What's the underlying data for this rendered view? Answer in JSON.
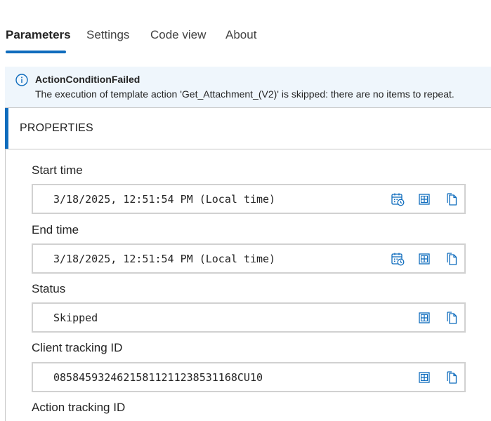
{
  "tabs": [
    {
      "label": "Parameters",
      "active": true
    },
    {
      "label": "Settings",
      "active": false
    },
    {
      "label": "Code view",
      "active": false
    },
    {
      "label": "About",
      "active": false
    }
  ],
  "banner": {
    "icon": "info-icon",
    "title": "ActionConditionFailed",
    "message": "The execution of template action 'Get_Attachment_(V2)' is skipped: there are no items to repeat."
  },
  "section": {
    "title": "PROPERTIES"
  },
  "fields": [
    {
      "label": "Start time",
      "value": "3/18/2025, 12:51:54 PM (Local time)",
      "actions": [
        "calendar-clock-icon",
        "table-view-icon",
        "copy-icon"
      ]
    },
    {
      "label": "End time",
      "value": "3/18/2025, 12:51:54 PM (Local time)",
      "actions": [
        "calendar-clock-icon",
        "table-view-icon",
        "copy-icon"
      ]
    },
    {
      "label": "Status",
      "value": "Skipped",
      "actions": [
        "table-view-icon",
        "copy-icon"
      ]
    },
    {
      "label": "Client tracking ID",
      "value": "08584593246215811211238531168CU10",
      "actions": [
        "table-view-icon",
        "copy-icon"
      ]
    },
    {
      "label": "Action tracking ID",
      "value": "",
      "actions": []
    }
  ],
  "colors": {
    "accent": "#0f6cbd",
    "banner_bg": "#eff6fc",
    "border": "#d1d1d1"
  }
}
